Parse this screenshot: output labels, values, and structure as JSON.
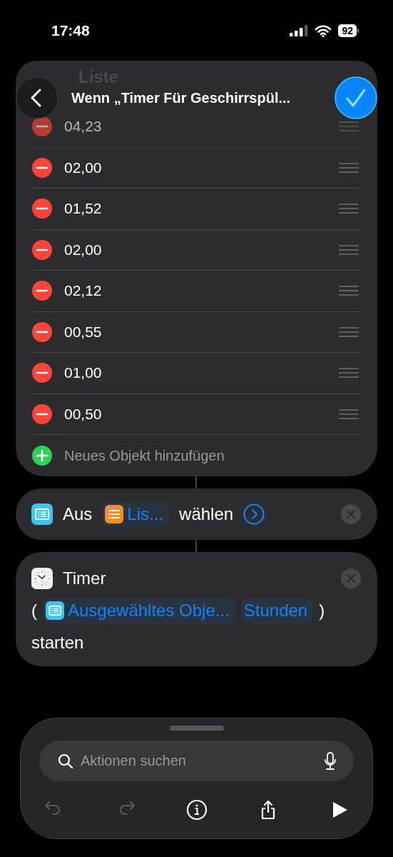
{
  "status_bar": {
    "time": "17:48",
    "battery": "92"
  },
  "nav": {
    "title": "Wenn „Timer Für Geschirrspül..."
  },
  "list_card": {
    "title": "Liste",
    "items": [
      {
        "value": "04,23"
      },
      {
        "value": "02,00"
      },
      {
        "value": "01,52"
      },
      {
        "value": "02,00"
      },
      {
        "value": "02,12"
      },
      {
        "value": "00,55"
      },
      {
        "value": "01,00"
      },
      {
        "value": "00,50"
      }
    ],
    "add_label": "Neues Objekt hinzufügen"
  },
  "actions": [
    {
      "kind": "choose",
      "title": "Aus",
      "tokens": [
        {
          "kind": "list",
          "text": "Lis..."
        }
      ],
      "suffix": "wählen"
    },
    {
      "kind": "timer",
      "title": "Timer",
      "open": "(",
      "tokens": [
        {
          "kind": "variable",
          "text": "Ausgewähltes Obje..."
        },
        {
          "kind": "plain",
          "text": "Stunden"
        }
      ],
      "close": ")",
      "suffix": "starten"
    }
  ],
  "search": {
    "placeholder": "Aktionen suchen"
  },
  "toolbar": [
    {
      "kind": "undo",
      "disabled": true
    },
    {
      "kind": "redo",
      "disabled": true
    },
    {
      "kind": "info",
      "disabled": false
    },
    {
      "kind": "share",
      "disabled": false
    },
    {
      "kind": "run",
      "disabled": false
    }
  ]
}
